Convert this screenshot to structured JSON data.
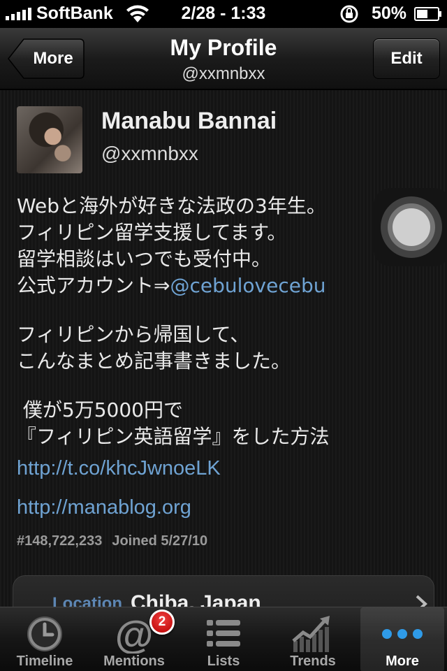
{
  "status_bar": {
    "carrier": "SoftBank",
    "time": "2/28 - 1:33",
    "battery": "50%"
  },
  "nav": {
    "back_label": "More",
    "title": "My Profile",
    "subtitle": "@xxmnbxx",
    "edit_label": "Edit"
  },
  "profile": {
    "name": "Manabu Bannai",
    "handle": "@xxmnbxx",
    "bio": {
      "line1": "Webと海外が好きな法政の3年生。",
      "line2": "フィリピン留学支援してます。",
      "line3": "留学相談はいつでも受付中。",
      "line4_prefix": "公式アカウント⇒",
      "line4_mention": "@cebulovecebu",
      "line5": "フィリピンから帰国して、",
      "line6": "こんなまとめ記事書きました。",
      "line7": " 僕が5万5000円で",
      "line8": "『フィリピン英語留学』をした方法"
    },
    "link1": "http://t.co/khcJwnoeLK",
    "link2": "http://manablog.org",
    "user_id": "#148,722,233",
    "joined": "Joined 5/27/10",
    "location_label": "Location",
    "location_value": "Chiba, Japan"
  },
  "tabs": [
    {
      "label": "Timeline",
      "icon": "clock-icon"
    },
    {
      "label": "Mentions",
      "icon": "at-icon",
      "badge": "2"
    },
    {
      "label": "Lists",
      "icon": "list-icon"
    },
    {
      "label": "Trends",
      "icon": "trends-icon"
    },
    {
      "label": "More",
      "icon": "more-dots-icon",
      "active": true
    }
  ],
  "colors": {
    "link": "#6fa3d3",
    "badge": "#d01010",
    "active_dots": "#2f9be8"
  }
}
